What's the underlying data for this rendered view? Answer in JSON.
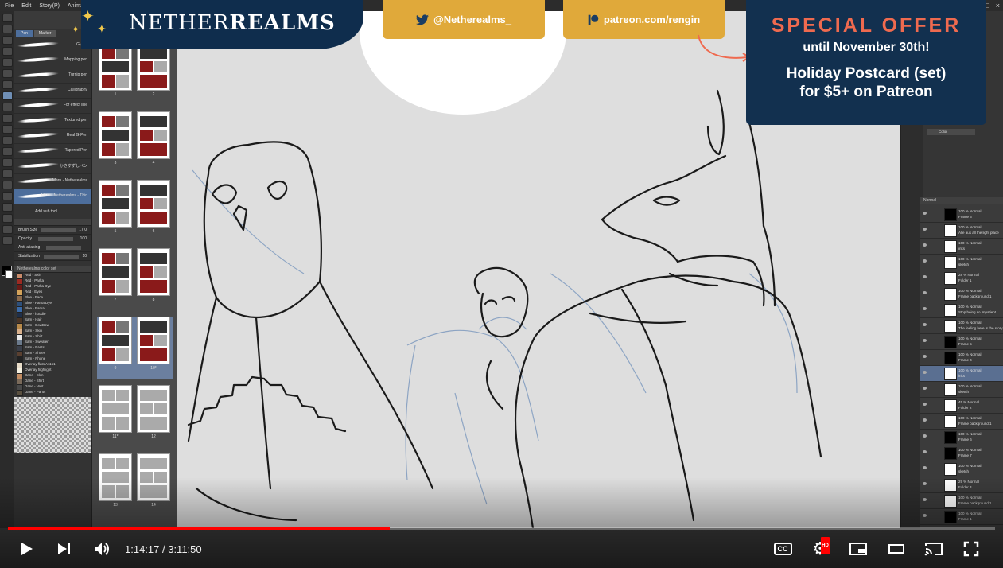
{
  "app": {
    "menu": [
      "File",
      "Edit",
      "Story(P)",
      "Animation"
    ],
    "window_controls": [
      "–",
      "□",
      "×"
    ]
  },
  "subtool": {
    "tabs": [
      "Pen",
      "Marker"
    ],
    "brushes": [
      "G-pen",
      "Mapping pen",
      "Turnip pen",
      "Calligraphy",
      "For effect line",
      "Textured pen",
      "Real G-Pen",
      "Tapered Pen",
      "かきすずしペン",
      "Maru - Netherealms",
      "Maru - Netherealms - Thin"
    ],
    "add_label": "Add sub tool",
    "properties": [
      {
        "name": "Brush Size",
        "value": "17.0"
      },
      {
        "name": "Opacity",
        "value": "100"
      },
      {
        "name": "Anti-aliasing",
        "value": ""
      },
      {
        "name": "Stabilization",
        "value": "10"
      }
    ],
    "color_set_name": "Netherealms color set",
    "colors": [
      {
        "name": "Red - Skin",
        "color": "#c98c6b"
      },
      {
        "name": "Red - Parka",
        "color": "#9c2a22"
      },
      {
        "name": "Red - Parka Dye",
        "color": "#6b1a16"
      },
      {
        "name": "Red - Eyes",
        "color": "#d4a35a"
      },
      {
        "name": "Blue - Face",
        "color": "#8a6a4c"
      },
      {
        "name": "Blue - Parka Dye",
        "color": "#2d4f7a"
      },
      {
        "name": "Blue - Parka",
        "color": "#3a6aa8"
      },
      {
        "name": "Blue - hoodie",
        "color": "#1f2f4a"
      },
      {
        "name": "Sam - Hair",
        "color": "#4a3526"
      },
      {
        "name": "Sam - BowBow",
        "color": "#b88a4a"
      },
      {
        "name": "Sam - Skin",
        "color": "#d9b08c"
      },
      {
        "name": "Sam - Shirt",
        "color": "#eaeaea"
      },
      {
        "name": "Sam - Sweater",
        "color": "#6b7a8c"
      },
      {
        "name": "Sam - Pants",
        "color": "#3a3f4a"
      },
      {
        "name": "Sam - Shoes",
        "color": "#5a4030"
      },
      {
        "name": "Sam - Phone",
        "color": "#222222"
      },
      {
        "name": "Overlay flats A1151",
        "color": "#e8dcc8"
      },
      {
        "name": "Overlay highlight",
        "color": "#f5f0e0"
      },
      {
        "name": "Dane - Skin",
        "color": "#c08a60"
      },
      {
        "name": "Dane - Shirt",
        "color": "#7a6a5a"
      },
      {
        "name": "Dane - Vest",
        "color": "#4a4a4a"
      },
      {
        "name": "Dane - Pants",
        "color": "#5a5040"
      }
    ]
  },
  "pages": {
    "numbers": [
      "1",
      "2",
      "3",
      "4",
      "5",
      "6",
      "7",
      "8",
      "9",
      "10*",
      "11*",
      "12",
      "13",
      "14"
    ]
  },
  "layers": {
    "blend": "Normal",
    "items": [
      {
        "l1": "100 % Normal",
        "l2": "Frame 3",
        "thumb": "black"
      },
      {
        "l1": "100 % Normal",
        "l2": "Alle aus all the light place",
        "thumb": "white"
      },
      {
        "l1": "100 % Normal",
        "l2": "inks",
        "thumb": "white"
      },
      {
        "l1": "100 % Normal",
        "l2": "sketch",
        "thumb": "white"
      },
      {
        "l1": "28 % Normal",
        "l2": "Folder 1",
        "thumb": "white"
      },
      {
        "l1": "100 % Normal",
        "l2": "Frame background 1",
        "thumb": "white"
      },
      {
        "l1": "100 % Normal",
        "l2": "Stop being so impatient",
        "thumb": "white"
      },
      {
        "l1": "100 % Normal",
        "l2": "The feeling here is the story",
        "thumb": "white"
      },
      {
        "l1": "100 % Normal",
        "l2": "Frame 5",
        "thumb": "black"
      },
      {
        "l1": "100 % Normal",
        "l2": "Frame 4",
        "thumb": "black"
      },
      {
        "l1": "100 % Normal",
        "l2": "inks",
        "thumb": "white",
        "selected": true
      },
      {
        "l1": "100 % Normal",
        "l2": "sketch",
        "thumb": "white"
      },
      {
        "l1": "45 % Normal",
        "l2": "Folder 2",
        "thumb": "white"
      },
      {
        "l1": "100 % Normal",
        "l2": "Frame background 1",
        "thumb": "white"
      },
      {
        "l1": "100 % Normal",
        "l2": "Frame 6",
        "thumb": "black"
      },
      {
        "l1": "100 % Normal",
        "l2": "Frame 7",
        "thumb": "black"
      },
      {
        "l1": "100 % Normal",
        "l2": "sketch",
        "thumb": "white"
      },
      {
        "l1": "29 % Normal",
        "l2": "Folder 3",
        "thumb": "white"
      },
      {
        "l1": "100 % Normal",
        "l2": "Frame background 1",
        "thumb": "white"
      },
      {
        "l1": "100 % Normal",
        "l2": "Frame 1",
        "thumb": "black"
      }
    ]
  },
  "color_picker_label": "Color",
  "overlay": {
    "logo_thin": "NETHER",
    "logo_bold": "REALMS",
    "twitter": "@Netherealms_",
    "patreon": "patreon.com/rengin",
    "offer_title": "SPECIAL OFFER",
    "offer_until": "until November 30th!",
    "offer_line1": "Holiday Postcard (set)",
    "offer_line2": "for $5+ on Patreon",
    "star_color": "#f2c94c",
    "tag_color": "#e0a93a",
    "navy": "#12304f"
  },
  "player": {
    "current_time": "1:14:17",
    "duration": "3:11:50",
    "time_display": "1:14:17 / 3:11:50",
    "played_fraction": 0.387,
    "buffered_fraction": 0.385,
    "cc_label": "CC",
    "hd_badge": "HD",
    "accent": "#ff0000"
  }
}
